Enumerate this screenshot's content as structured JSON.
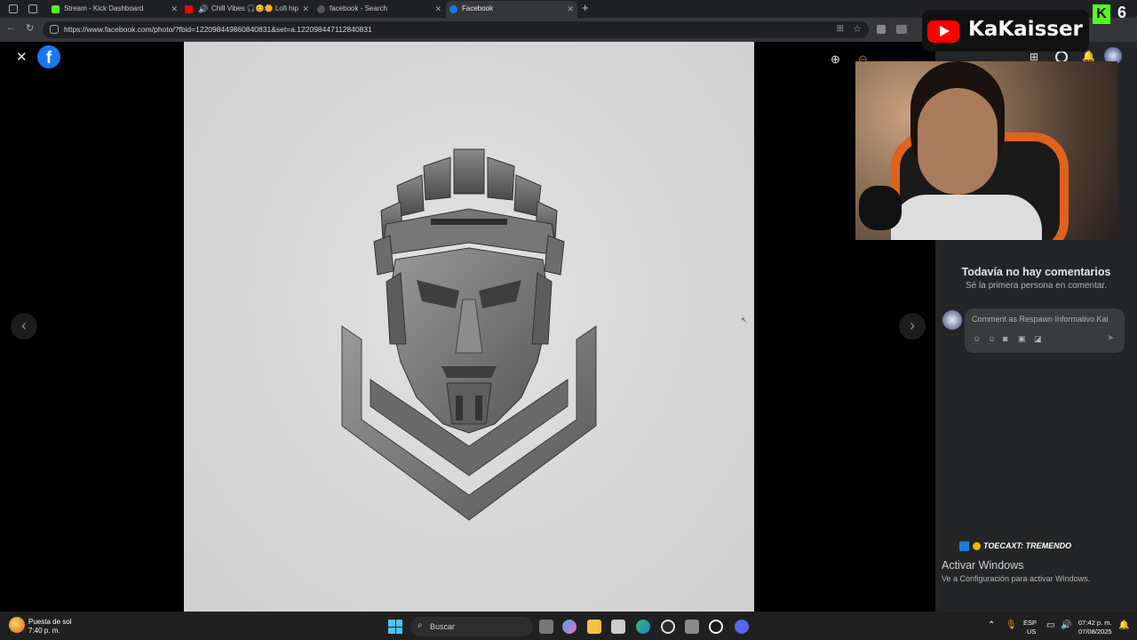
{
  "browser": {
    "tabs": [
      {
        "title": "Stream - Kick Dashboard",
        "icon": "kick-icon",
        "color": "#53fc18"
      },
      {
        "title": "Chill Vibes 🎧😊🌼 Lofi hip",
        "icon": "youtube-icon",
        "color": "#ff0000"
      },
      {
        "title": "facebook - Search",
        "icon": "search-icon",
        "color": "#888888"
      },
      {
        "title": "Facebook",
        "icon": "facebook-icon",
        "color": "#1877f2"
      }
    ],
    "new_tab_label": "+",
    "url": "https://www.facebook.com/photo/?fbid=122098449860840831&set=a.122098447112840831"
  },
  "viewer": {
    "close_label": "✕",
    "prev_label": "‹",
    "next_label": "›",
    "accent": "#1877f2"
  },
  "comments": {
    "empty_title": "Todavía no hay comentarios",
    "empty_subtitle": "Sé la primera persona en comentar.",
    "placeholder": "Comment as Respawn Informativo Kai"
  },
  "stream_overlay": {
    "channel_name": "KaKaisser",
    "kick_count": "6",
    "ticker": "TOECAXT: TREMENDO"
  },
  "windows": {
    "activate_title": "Activar Windows",
    "activate_subtitle": "Ve a Configuración para activar Windows."
  },
  "taskbar": {
    "weather_label": "Puesta de sol",
    "weather_time": "7:40 p. m.",
    "search_label": "Buscar",
    "lang_top": "ESP",
    "lang_bottom": "US",
    "clock_time": "07:42 p. m.",
    "clock_date": "07/08/2025"
  }
}
